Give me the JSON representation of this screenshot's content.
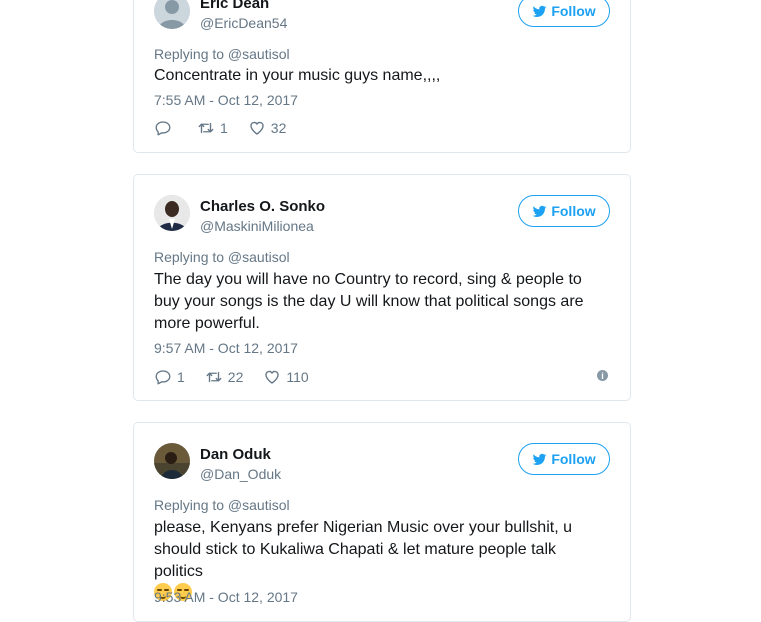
{
  "follow_label": "Follow",
  "tweets": [
    {
      "name": "Eric Dean",
      "handle": "@EricDean54",
      "replying_to": "Replying to @sautisol",
      "text": "Concentrate in your music guys name,,,,",
      "time": "7:55 AM - Oct 12, 2017",
      "reply_count": "",
      "retweet_count": "1",
      "like_count": "32",
      "avatar": "default-avatar"
    },
    {
      "name": "Charles O. Sonko",
      "handle": "@MaskiniMilionea",
      "replying_to": "Replying to @sautisol",
      "text": "The day you will have no Country to record, sing & people to buy your songs is the day U will know that political songs are more powerful.",
      "time": "9:57 AM - Oct 12, 2017",
      "reply_count": "1",
      "retweet_count": "22",
      "like_count": "110",
      "avatar": "photo-avatar"
    },
    {
      "name": "Dan Oduk",
      "handle": "@Dan_Oduk",
      "replying_to": "Replying to @sautisol",
      "text": "please, Kenyans prefer Nigerian Music over your bullshit, u should stick to Kukaliwa Chapati & let mature people talk politics",
      "time": "9:53 AM - Oct 12, 2017",
      "emojis": [
        "relieved-face",
        "relieved-face"
      ],
      "avatar": "photo-avatar"
    }
  ],
  "colors": {
    "accent": "#1da1f2",
    "muted": "#657786",
    "border": "#e1e8ed"
  }
}
